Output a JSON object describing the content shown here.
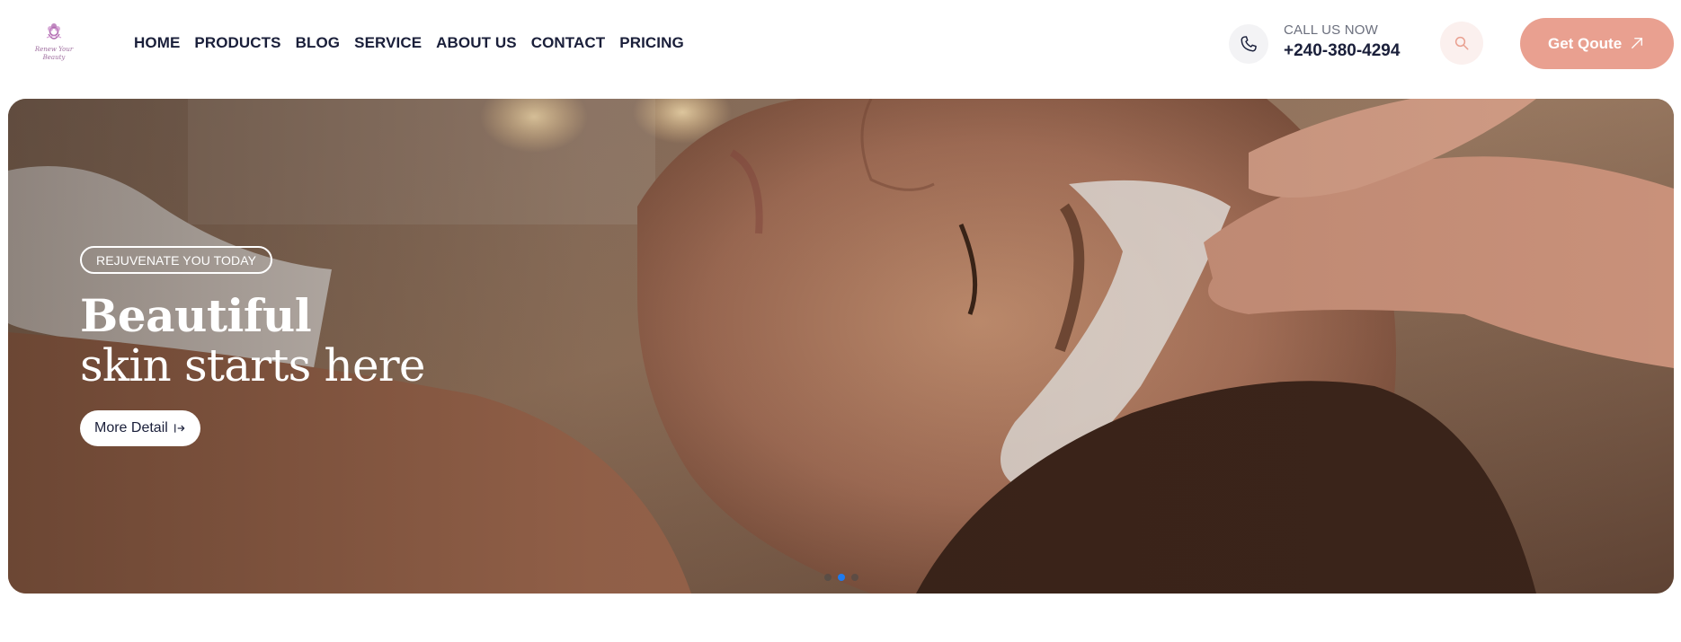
{
  "logo": {
    "line1": "Renew Your",
    "line2": "Beauty",
    "accent_color": "#b06cb0"
  },
  "nav": {
    "items": [
      "HOME",
      "PRODUCTS",
      "BLOG",
      "SERVICE",
      "ABOUT US",
      "CONTACT",
      "PRICING"
    ]
  },
  "contact": {
    "label": "CALL US NOW",
    "phone": "+240-380-4294",
    "icon": "phone-icon"
  },
  "search": {
    "icon": "search-icon"
  },
  "cta": {
    "label": "Get Qoute",
    "icon": "arrow-up-right-icon",
    "color": "#e9a090"
  },
  "hero": {
    "badge": "REJUVENATE YOU TODAY",
    "title_bold": "Beautiful",
    "title_regular": "skin starts here",
    "button_label": "More Detail",
    "button_icon": "arrow-right-to-bar-icon",
    "slides": {
      "count": 3,
      "active_index": 1
    },
    "image": "woman-facial-treatment-photo"
  }
}
